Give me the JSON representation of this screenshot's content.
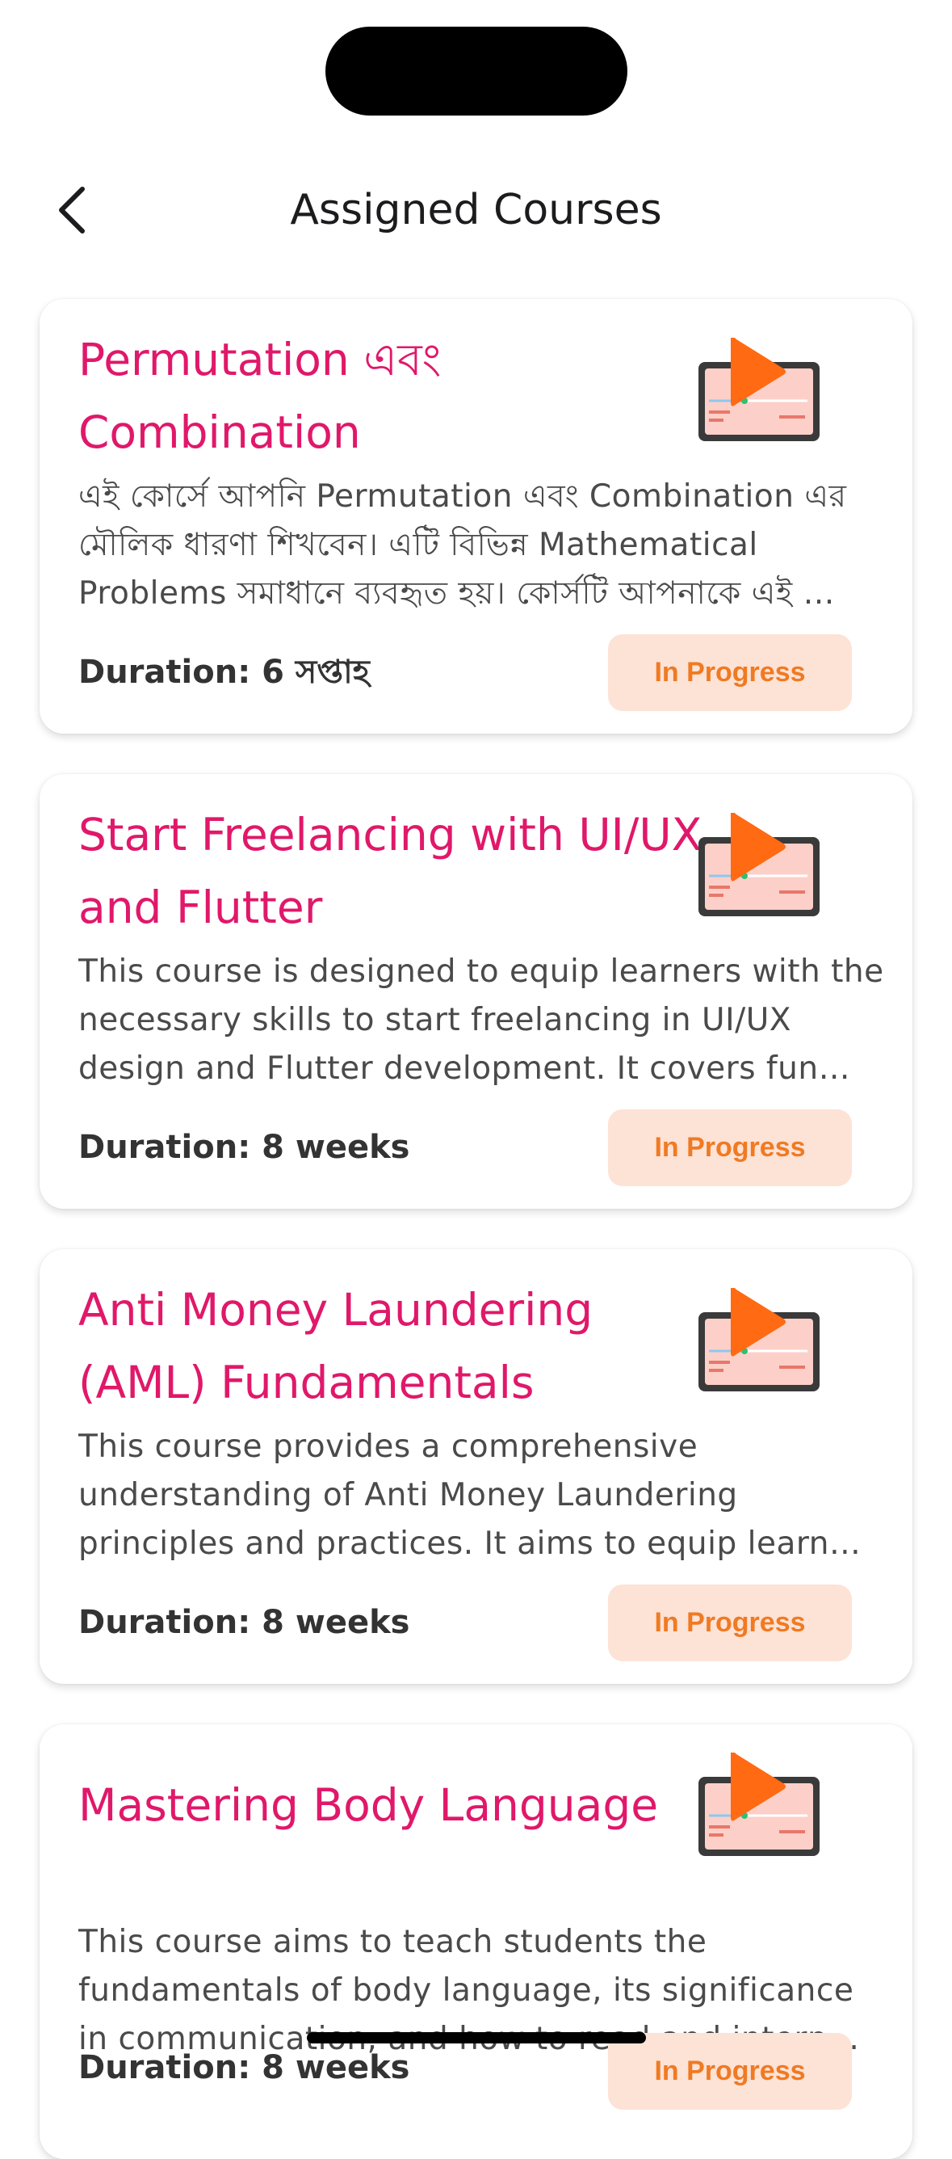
{
  "header": {
    "title": "Assigned Courses"
  },
  "courses": [
    {
      "title": "Permutation এবং Combination",
      "description": "এই কোর্সে আপনি Permutation এবং Combination এর মৌলিক ধারণা শিখবেন। এটি বিভিন্ন Mathematical Problems সমাধানে ব্যবহৃত হয়। কোর্সটি আপনাকে এই …",
      "duration": "Duration: 6 সপ্তাহ",
      "status": "In Progress"
    },
    {
      "title": "Start Freelancing with UI/UX and Flutter",
      "description": "This course is designed to equip learners with the necessary skills to start freelancing in UI/UX design and Flutter development. It covers fun…",
      "duration": "Duration: 8 weeks",
      "status": "In Progress"
    },
    {
      "title": "Anti Money Laundering (AML) Fundamentals",
      "description": "This course provides a comprehensive understanding of Anti Money Laundering principles and practices. It aims to equip learn…",
      "duration": "Duration: 8 weeks",
      "status": "In Progress"
    },
    {
      "title": "Mastering Body Language",
      "description": "This course aims to teach students the fundamentals of body language, its significance in communication, and how to read and interp…",
      "duration": "Duration: 8 weeks",
      "status": "In Progress"
    }
  ],
  "colors": {
    "title": "#e0186a",
    "status_bg": "#fde2d6",
    "status_text": "#f07a22"
  },
  "icons": {
    "back": "chevron-left-icon",
    "thumbnail": "video-course-icon"
  }
}
